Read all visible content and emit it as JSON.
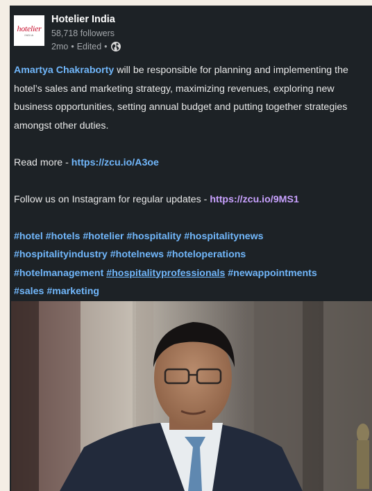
{
  "post": {
    "author": "Hotelier India",
    "followers": "58,718 followers",
    "time": "2mo",
    "edited": "Edited",
    "logo_text": "hotelier",
    "logo_sub": "INDIA",
    "mention": "Amartya Chakraborty",
    "body_rest": " will be responsible for planning and implementing the hotel’s sales and marketing strategy, maximizing revenues, exploring new business opportunities, setting annual budget and putting together strategies amongst other duties.",
    "read_more_label": "Read more - ",
    "read_more_link": "https://zcu.io/A3oe",
    "follow_label": "Follow us on Instagram for regular updates - ",
    "follow_link": "https://zcu.io/9MS1",
    "hashtags": [
      "#hotel",
      "#hotels",
      "#hotelier",
      "#hospitality",
      "#hospitalitynews",
      "#hospitalityindustry",
      "#hotelnews",
      "#hoteloperations",
      "#hotelmanagement",
      "#hospitalityprofessionals",
      "#newappointments",
      "#sales",
      "#marketing"
    ],
    "globe_icon": "globe-icon"
  },
  "colors": {
    "card_bg": "#1d2226",
    "link_blue": "#71b7fb",
    "link_purple": "#c9a2ff",
    "page_bg": "#f4eee5"
  }
}
